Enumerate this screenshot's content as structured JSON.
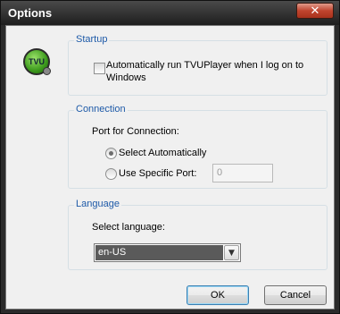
{
  "window": {
    "title": "Options",
    "close_glyph": "✕"
  },
  "logo": {
    "text": "TVU",
    "icon": "tvu-logo-icon"
  },
  "startup": {
    "legend": "Startup",
    "autorun_label": "Automatically run TVUPlayer when I log on to Windows",
    "autorun_checked": false
  },
  "connection": {
    "legend": "Connection",
    "port_label": "Port for Connection:",
    "auto_label": "Select Automatically",
    "specific_label": "Use Specific Port:",
    "selected": "auto",
    "port_value": "0"
  },
  "language": {
    "legend": "Language",
    "select_label": "Select language:",
    "value": "en-US"
  },
  "buttons": {
    "ok": "OK",
    "cancel": "Cancel"
  },
  "colors": {
    "legend": "#1e5aa8",
    "titlebar": "#2b2b2b"
  }
}
